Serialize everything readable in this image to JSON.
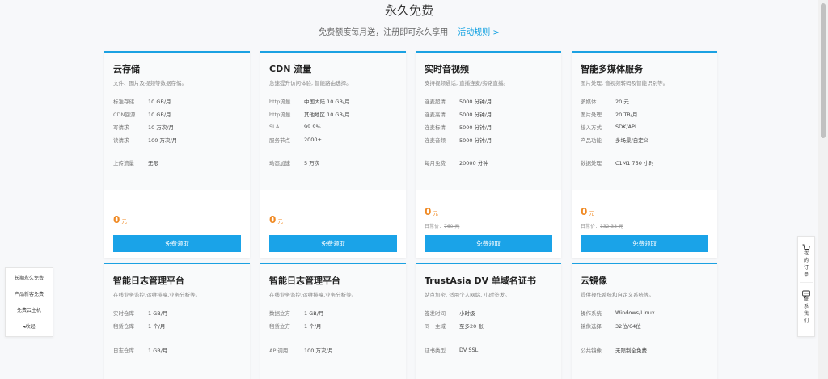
{
  "hero": {
    "title": "永久免费",
    "subtitle": "免费额度每月送，注册即可永久享用",
    "link": "活动规则 >"
  },
  "claim_label": "免费领取",
  "cards_row1": [
    {
      "name": "云存储",
      "desc": "文件、图片及视频等数据存储。",
      "specs": [
        {
          "k": "标准存储",
          "v": "10 GB/月"
        },
        {
          "k": "CDN回源",
          "v": "10 GB/月"
        },
        {
          "k": "写请求",
          "v": "10 万次/月"
        },
        {
          "k": "读请求",
          "v": "100 万次/月"
        }
      ],
      "extra": {
        "k": "上传流量",
        "v": "无限"
      },
      "price": "0",
      "unit": "元",
      "orig_label": "",
      "orig_value": ""
    },
    {
      "name": "CDN 流量",
      "desc": "急速提升访问体验, 智能路由选择。",
      "specs": [
        {
          "k": "http流量",
          "v": "中国大陆 10 GB/月"
        },
        {
          "k": "http流量",
          "v": "其他地区 10 GB/月"
        },
        {
          "k": "SLA",
          "v": "99.9%"
        },
        {
          "k": "服务节点",
          "v": "2000+"
        }
      ],
      "extra": {
        "k": "动态加速",
        "v": "5 万次"
      },
      "price": "0",
      "unit": "元",
      "orig_label": "",
      "orig_value": ""
    },
    {
      "name": "实时音视频",
      "desc": "支持视频通话, 直播连麦/旁路直播。",
      "specs": [
        {
          "k": "连麦超清",
          "v": "5000 分钟/月"
        },
        {
          "k": "连麦高清",
          "v": "5000 分钟/月"
        },
        {
          "k": "连麦标清",
          "v": "5000 分钟/月"
        },
        {
          "k": "连麦音频",
          "v": "5000 分钟/月"
        }
      ],
      "extra": {
        "k": "每月免费",
        "v": "20000 分钟"
      },
      "price": "0",
      "unit": "元",
      "orig_label": "日常价：",
      "orig_value": "760 元"
    },
    {
      "name": "智能多媒体服务",
      "desc": "图片处理, 音视频转码及智能识别等。",
      "specs": [
        {
          "k": "多媒体",
          "v": "20 元"
        },
        {
          "k": "图片处理",
          "v": "20 TB/月"
        },
        {
          "k": "接入方式",
          "v": "SDK/API"
        },
        {
          "k": "产品功能",
          "v": "多场景/自定义"
        }
      ],
      "extra": {
        "k": "数据处理",
        "v": "C1M1 750 小时"
      },
      "price": "0",
      "unit": "元",
      "orig_label": "日常价：",
      "orig_value": "132.33 元"
    }
  ],
  "cards_row2": [
    {
      "name": "智能日志管理平台",
      "desc": "在线业务监控,运维排障,业务分析等。",
      "specs": [
        {
          "k": "实时仓库",
          "v": "1 GB/月"
        },
        {
          "k": "租赁仓库",
          "v": "1 个/月"
        }
      ],
      "extra": {
        "k": "日志仓库",
        "v": "1 GB/月"
      }
    },
    {
      "name": "智能日志管理平台",
      "desc": "在线业务监控,运维排障,业务分析等。",
      "specs": [
        {
          "k": "数据立方",
          "v": "1 GB/月"
        },
        {
          "k": "租赁立方",
          "v": "1 个/月"
        }
      ],
      "extra": {
        "k": "API调用",
        "v": "100 万次/月"
      }
    },
    {
      "name": "TrustAsia DV 单域名证书",
      "desc": "站点加密, 适用个人网站, 小时签发。",
      "specs": [
        {
          "k": "签发时间",
          "v": "小时级"
        },
        {
          "k": "同一主域",
          "v": "至多20 张"
        }
      ],
      "extra": {
        "k": "证书类型",
        "v": "DV SSL"
      }
    },
    {
      "name": "云镜像",
      "desc": "提供操作系统和自定义系统等。",
      "specs": [
        {
          "k": "操作系统",
          "v": "Windows/Linux"
        },
        {
          "k": "镜像选择",
          "v": "32位/64位"
        }
      ],
      "extra": {
        "k": "公共镜像",
        "v": "无限制全免费"
      }
    }
  ],
  "float_left": [
    "长期永久免费",
    "产品新客免费",
    "免费云主机",
    "◂收起"
  ],
  "float_right": {
    "orders": "我的订单",
    "contact": "联系我们"
  },
  "colors": {
    "accent": "#1aa3e8",
    "price": "#f08a24",
    "link": "#0a9ee0"
  }
}
